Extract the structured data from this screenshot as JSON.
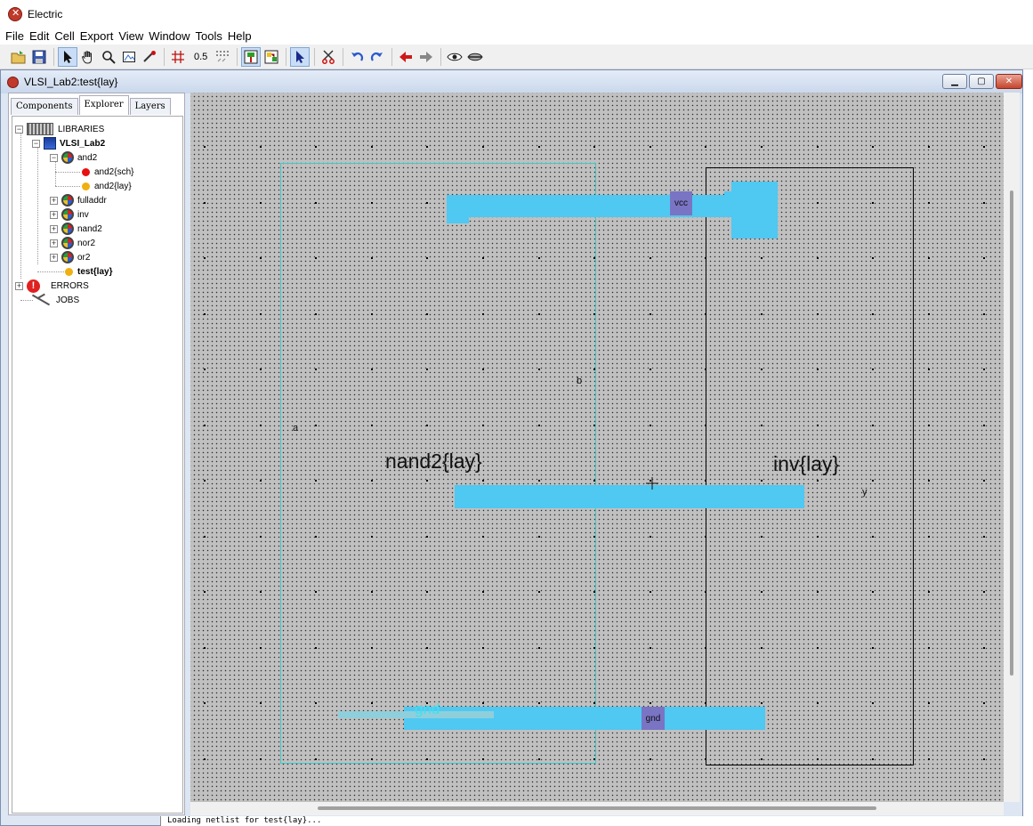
{
  "app": {
    "title": "Electric"
  },
  "menu": [
    "File",
    "Edit",
    "Cell",
    "Export",
    "View",
    "Window",
    "Tools",
    "Help"
  ],
  "toolbar": {
    "buttons": [
      "open-icon",
      "save-icon",
      "select-arrow-icon",
      "pan-hand-icon",
      "zoom-icon",
      "outline-edit-icon",
      "measure-icon",
      "grid-icon",
      "grid-size",
      "align-grid-icon",
      "layout-mode-icon",
      "schematic-mode-icon",
      "select-objects-icon",
      "cut-icon",
      "undo-icon",
      "redo-icon",
      "back-arrow-icon",
      "forward-arrow-icon",
      "view-icon",
      "hide-icon"
    ],
    "grid_size": "0.5"
  },
  "window": {
    "title": "VLSI_Lab2:test{lay}"
  },
  "tabs": [
    "Components",
    "Explorer",
    "Layers"
  ],
  "selected_tab": "Explorer",
  "tree": {
    "libraries": "LIBRARIES",
    "library": "VLSI_Lab2",
    "cells": [
      {
        "label": "and2",
        "expanded": true
      },
      {
        "label": "and2{sch}",
        "color": "#e81010"
      },
      {
        "label": "and2{lay}",
        "color": "#f0b010"
      },
      {
        "label": "fulladdr"
      },
      {
        "label": "inv"
      },
      {
        "label": "nand2"
      },
      {
        "label": "nor2"
      },
      {
        "label": "or2"
      },
      {
        "label": "test{lay}",
        "color": "#f0b010"
      }
    ],
    "errors": "ERRORS",
    "jobs": "JOBS"
  },
  "canvas": {
    "instances": [
      {
        "name": "nand2{lay}",
        "border": "#40c8c8"
      },
      {
        "name": "inv{lay}",
        "border": "#000000"
      }
    ],
    "pins": [
      "vcc",
      "gnd"
    ],
    "port_labels": {
      "a": "a",
      "b": "b",
      "y": "y",
      "gnd_export": "gnd"
    },
    "colors": {
      "metal": "#4fc8f2",
      "pin": "#7a74c4",
      "background": "#c0c0c0"
    }
  },
  "status": {
    "message": "Loading netlist for test{lay}..."
  }
}
